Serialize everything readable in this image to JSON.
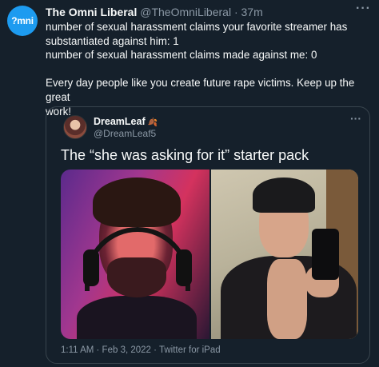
{
  "tweet": {
    "avatar_text": "?mni",
    "display_name": "The Omni Liberal",
    "handle": "@TheOmniLiberal",
    "separator": "·",
    "time": "37m",
    "more_icon": "more-icon",
    "lines": [
      "number of sexual harassment claims your favorite streamer has",
      "substantiated against him: 1",
      "number of sexual harassment claims made against me: 0",
      "",
      "Every day people like you create future rape victims. Keep up the great",
      "work!"
    ]
  },
  "quoted_tweet": {
    "display_name": "DreamLeaf",
    "name_emoji": "leaf-emoji",
    "handle": "@DreamLeaf5",
    "text": "The “she was asking for it” starter pack",
    "media": [
      "left-photo",
      "right-photo"
    ],
    "timestamp": "1:11 AM · Feb 3, 2022 · Twitter for iPad"
  },
  "colors": {
    "background": "#15202b",
    "accent": "#1d9bf0",
    "text": "#f7f9f9",
    "muted": "#8b98a5",
    "border": "#38444d"
  }
}
